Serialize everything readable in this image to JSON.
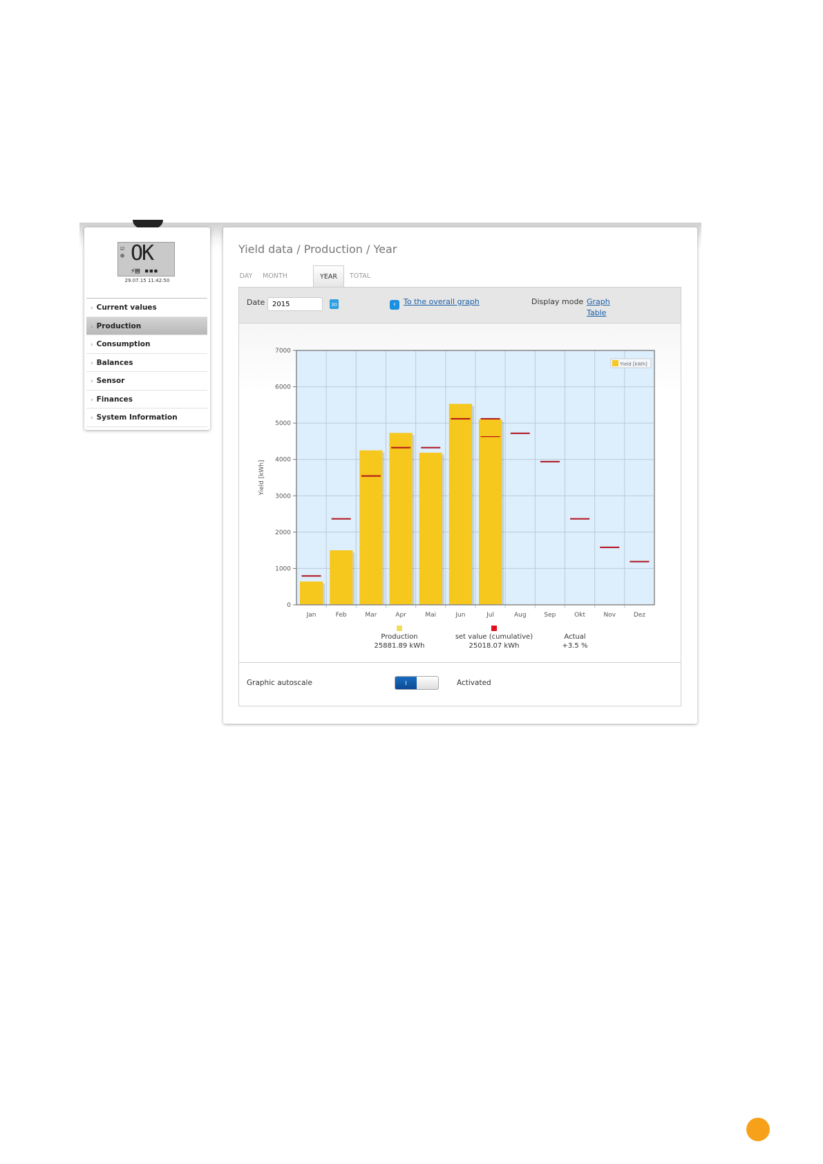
{
  "sidebar": {
    "status_display": "OK",
    "timestamp": "29.07.15 11:42:50",
    "items": [
      {
        "label": "Current values"
      },
      {
        "label": "Production",
        "active": true
      },
      {
        "label": "Consumption"
      },
      {
        "label": "Balances"
      },
      {
        "label": "Sensor"
      },
      {
        "label": "Finances"
      },
      {
        "label": "System Information"
      }
    ],
    "chevron": "›"
  },
  "main": {
    "breadcrumb": "Yield data / Production / Year",
    "tabs": [
      {
        "label": "DAY"
      },
      {
        "label": "MONTH"
      },
      {
        "label": "YEAR",
        "active": true
      },
      {
        "label": "TOTAL"
      }
    ],
    "date_label": "Date",
    "date_value": "2015",
    "calendar_icon": "30",
    "overall_link": "To the overall graph",
    "display_mode_label": "Display mode",
    "mode_graph": "Graph",
    "mode_table": "Table",
    "autoscale_label": "Graphic autoscale",
    "toggle_on_label": "I",
    "autoscale_state": "Activated"
  },
  "chart_data": {
    "type": "bar",
    "ylabel": "Yield [kWh]",
    "ylim": [
      0,
      7000
    ],
    "yticks": [
      0,
      1000,
      2000,
      3000,
      4000,
      5000,
      6000,
      7000
    ],
    "categories": [
      "Jan",
      "Feb",
      "Mar",
      "Apr",
      "Mai",
      "Jun",
      "Jul",
      "Aug",
      "Sep",
      "Okt",
      "Nov",
      "Dez"
    ],
    "series": [
      {
        "name": "Yield [kWh]",
        "type": "bar",
        "color": "#f6c71c",
        "values": [
          640,
          1500,
          4250,
          4730,
          4185,
          5530,
          5105,
          null,
          null,
          null,
          null,
          null
        ]
      },
      {
        "name": "set value",
        "type": "marker",
        "color": "#b0101c",
        "values": [
          795,
          2365,
          3545,
          4325,
          4325,
          5120,
          5120,
          4720,
          3940,
          2365,
          1580,
          1190
        ]
      },
      {
        "name": "set value (partial)",
        "type": "marker",
        "color": "#c0101c",
        "values": [
          null,
          null,
          null,
          null,
          null,
          null,
          4630,
          null,
          null,
          null,
          null,
          null
        ]
      }
    ],
    "legend": "top-right",
    "legend_label": "Yield [kWh]",
    "grid": true,
    "summary": [
      {
        "label": "Production",
        "value": "25881.89 kWh",
        "color": "#f2dd5a"
      },
      {
        "label": "set value (cumulative)",
        "value": "25018.07 kWh",
        "color": "#e0101c"
      },
      {
        "label": "Actual",
        "value": "+3.5 %"
      }
    ]
  }
}
